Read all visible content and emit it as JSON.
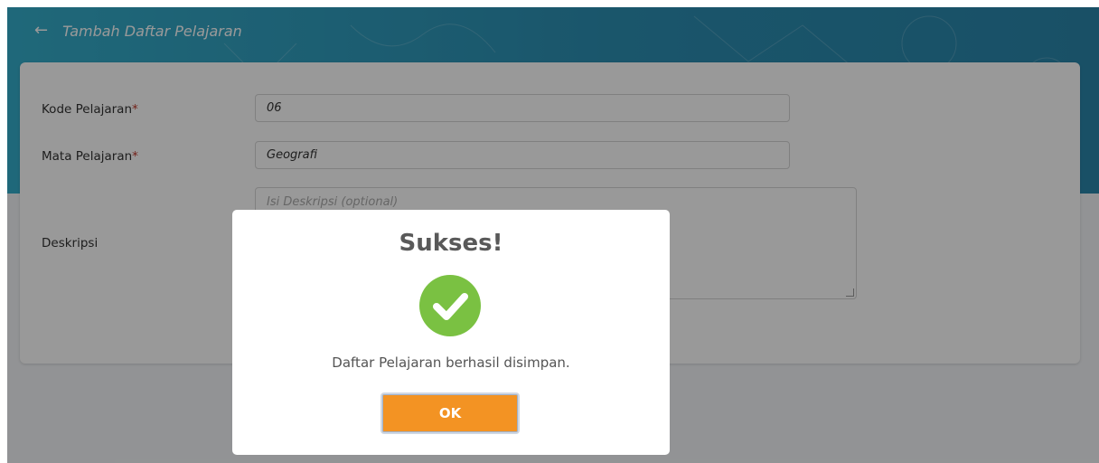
{
  "header": {
    "title": "Tambah Daftar Pelajaran",
    "back_icon": "arrow-left-icon"
  },
  "form": {
    "kode": {
      "label": "Kode Pelajaran",
      "required_mark": "*",
      "value": "06"
    },
    "mata": {
      "label": "Mata Pelajaran",
      "required_mark": "*",
      "value": "Geografi"
    },
    "deskripsi": {
      "label": "Deskripsi",
      "placeholder": "Isi Deskripsi (optional)"
    }
  },
  "modal": {
    "title": "Sukses!",
    "icon": "check-circle-icon",
    "message": "Daftar Pelajaran berhasil disimpan.",
    "ok_label": "OK"
  },
  "colors": {
    "header_start": "#35aecb",
    "header_end": "#2a86ab",
    "success_green": "#7ac142",
    "ok_orange": "#f39323",
    "required_red": "#c0392b"
  }
}
